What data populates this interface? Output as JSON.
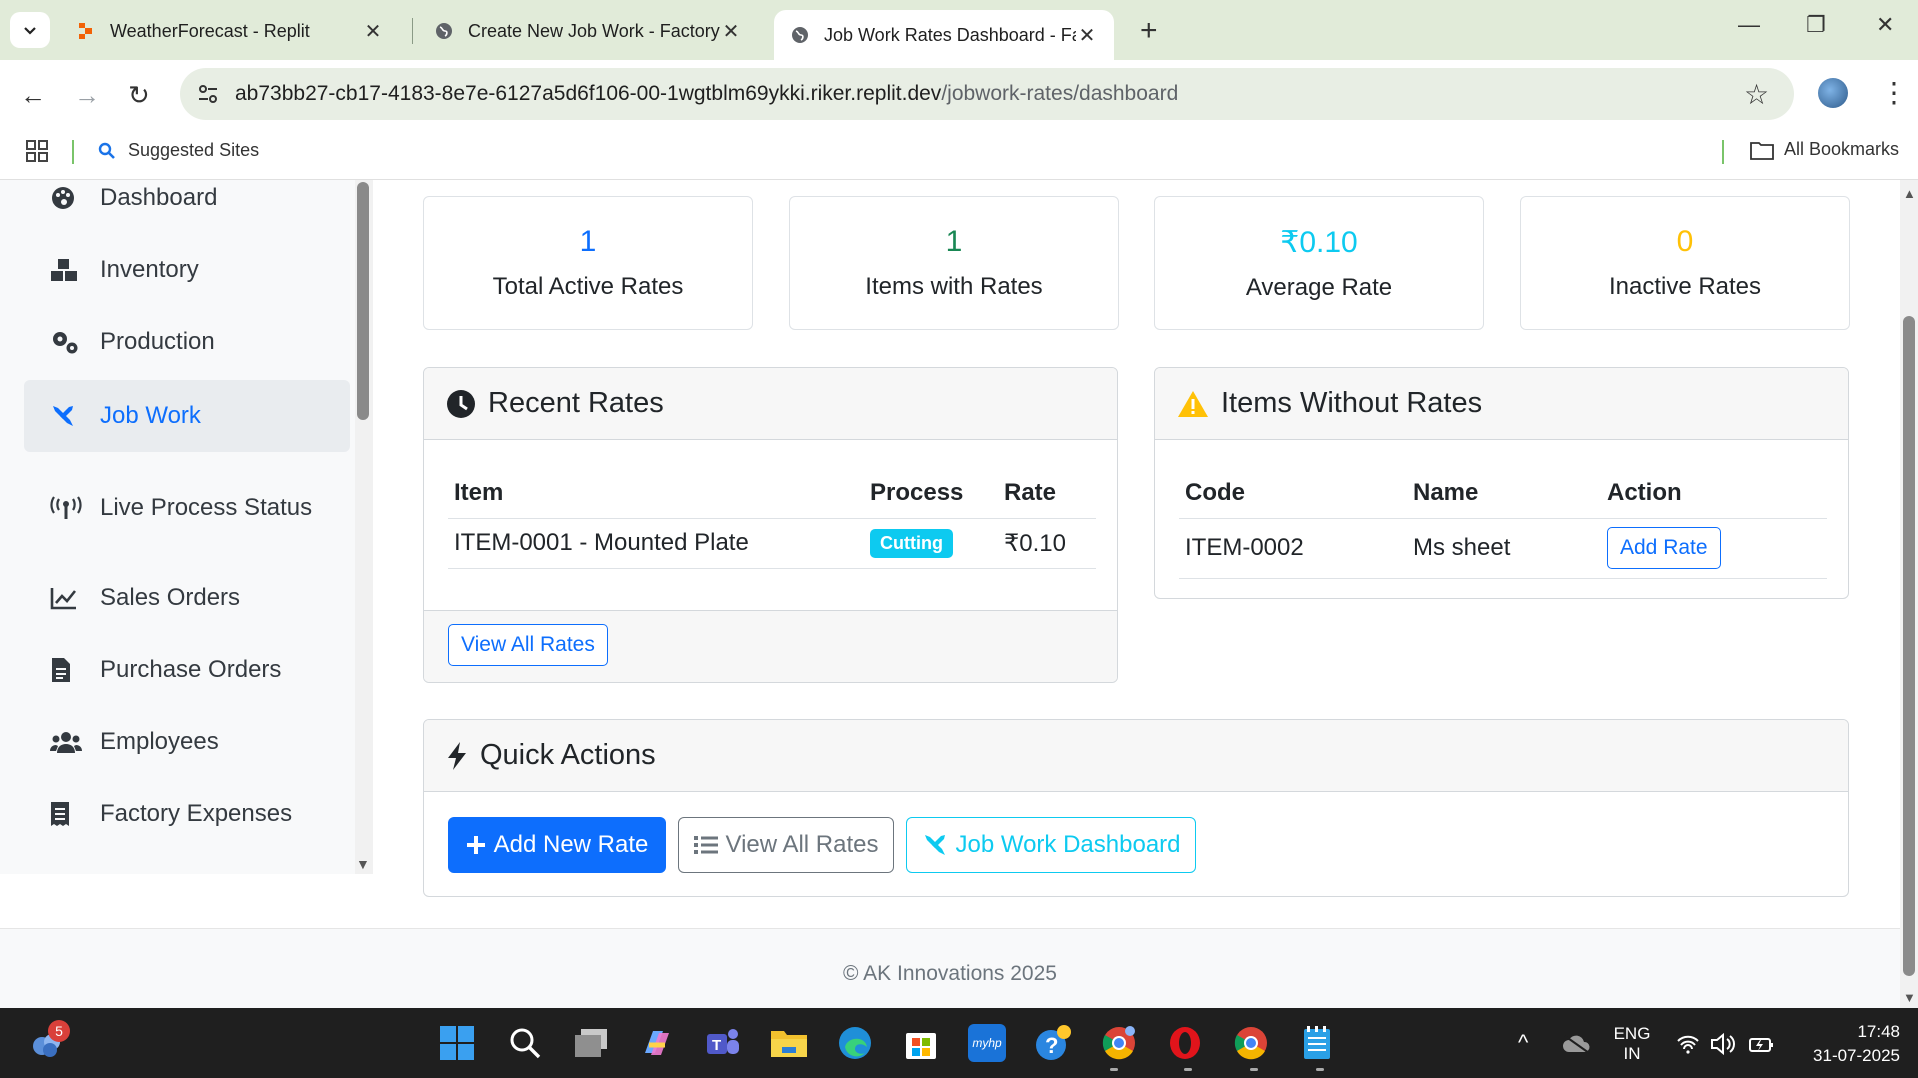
{
  "browser": {
    "tabs": [
      {
        "title": "WeatherForecast - Replit"
      },
      {
        "title": "Create New Job Work - Factory"
      },
      {
        "title": "Job Work Rates Dashboard - Fa"
      }
    ],
    "url_host": "ab73bb27-cb17-4183-8e7e-6127a5d6f106-00-1wgtblm69ykki.riker.replit.dev",
    "url_path": "/jobwork-rates/dashboard",
    "bookmark": "Suggested Sites",
    "all_bookmarks": "All Bookmarks"
  },
  "sidebar": {
    "items": [
      {
        "label": "Dashboard",
        "icon": "palette-icon"
      },
      {
        "label": "Inventory",
        "icon": "boxes-icon"
      },
      {
        "label": "Production",
        "icon": "cogs-icon"
      },
      {
        "label": "Job Work",
        "icon": "tools-icon"
      },
      {
        "label": "Live Process Status",
        "icon": "broadcast-icon"
      },
      {
        "label": "Sales Orders",
        "icon": "chart-line-icon"
      },
      {
        "label": "Purchase Orders",
        "icon": "file-invoice-icon"
      },
      {
        "label": "Employees",
        "icon": "users-icon"
      },
      {
        "label": "Factory Expenses",
        "icon": "receipt-icon"
      }
    ]
  },
  "stats": [
    {
      "value": "1",
      "label": "Total Active Rates",
      "color": "#0d6efd"
    },
    {
      "value": "1",
      "label": "Items with Rates",
      "color": "#198754"
    },
    {
      "value": "₹0.10",
      "label": "Average Rate",
      "color": "#0dcaf0"
    },
    {
      "value": "0",
      "label": "Inactive Rates",
      "color": "#ffc107"
    }
  ],
  "recent_rates": {
    "title": "Recent Rates",
    "columns": [
      "Item",
      "Process",
      "Rate"
    ],
    "rows": [
      {
        "item": "ITEM-0001 - Mounted Plate",
        "process": "Cutting",
        "rate": "₹0.10"
      }
    ],
    "view_all": "View All Rates"
  },
  "items_without_rates": {
    "title": "Items Without Rates",
    "columns": [
      "Code",
      "Name",
      "Action"
    ],
    "rows": [
      {
        "code": "ITEM-0002",
        "name": "Ms sheet",
        "action": "Add Rate"
      }
    ]
  },
  "quick_actions": {
    "title": "Quick Actions",
    "add_new": "Add New Rate",
    "view_all": "View All Rates",
    "dashboard": "Job Work Dashboard"
  },
  "footer": "© AK Innovations 2025",
  "taskbar": {
    "notification_count": "5",
    "lang": "ENG",
    "region": "IN",
    "time": "17:48",
    "date": "31-07-2025"
  }
}
